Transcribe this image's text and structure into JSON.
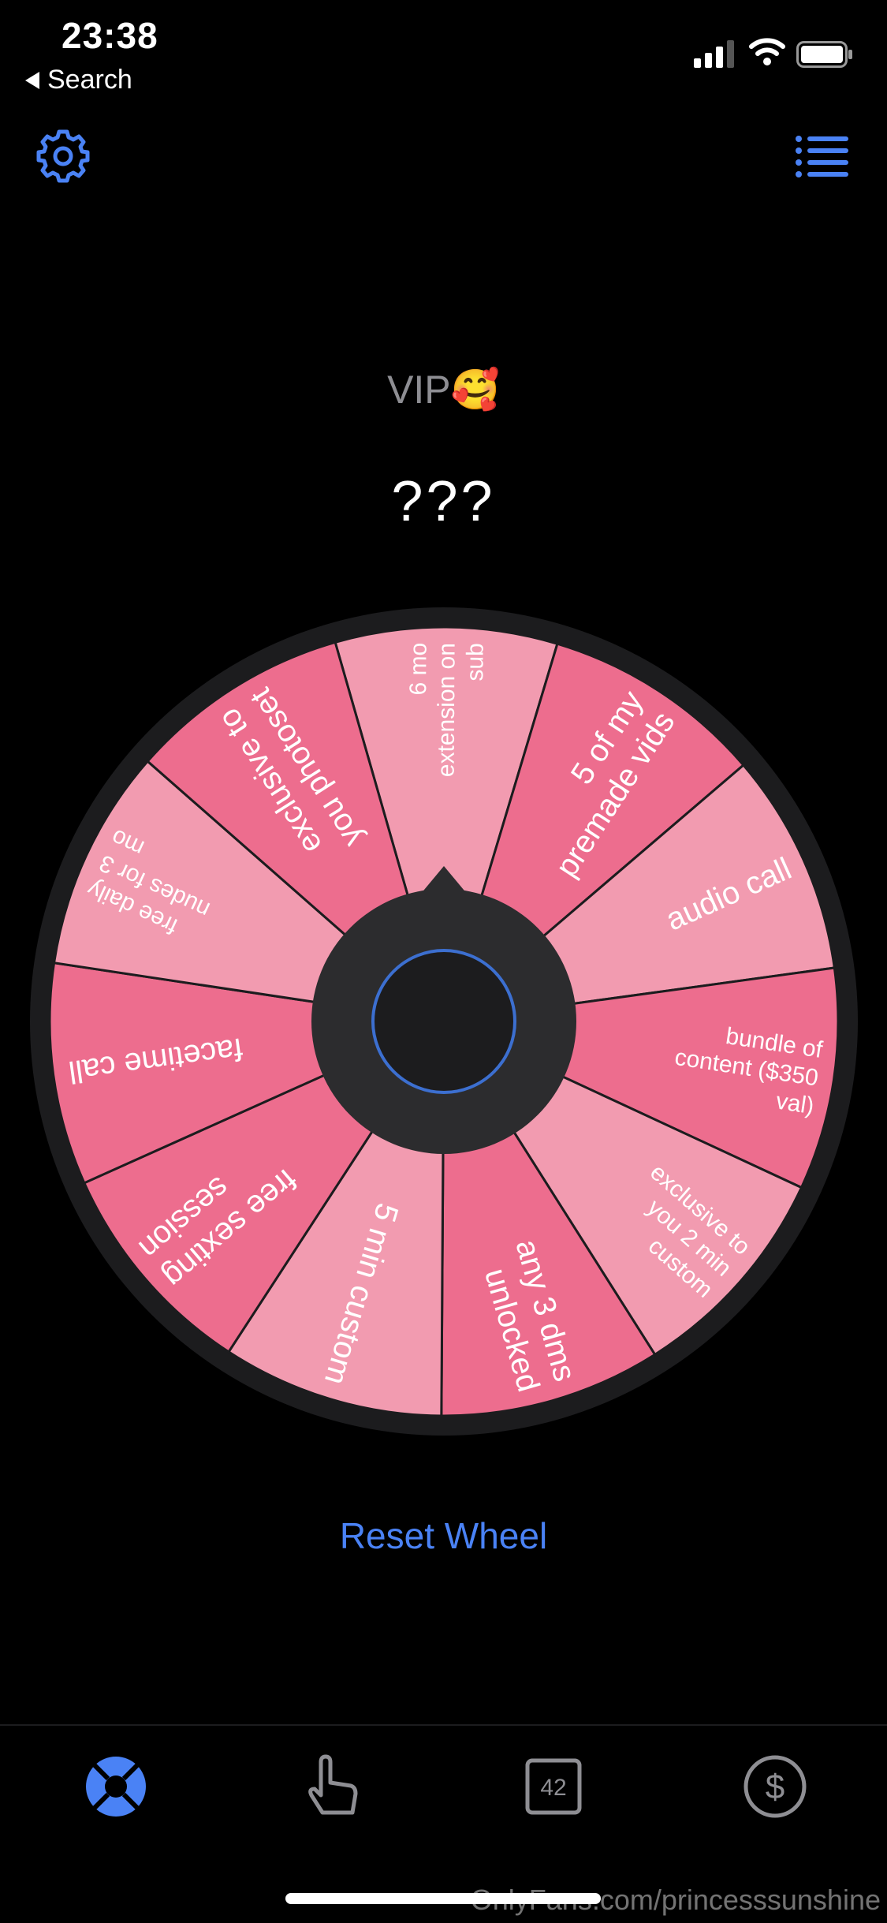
{
  "status_bar": {
    "time": "23:38",
    "back_label": "Search"
  },
  "wheel": {
    "name": "VIP🥰",
    "result": "???",
    "segments": [
      {
        "label": "6 mo extension on sub",
        "color": "#f29bb0"
      },
      {
        "label": "5 of my premade vids",
        "color": "#ed6d8e"
      },
      {
        "label": "audio call",
        "color": "#f29bb0"
      },
      {
        "label": "bundle of content ($350 val)",
        "color": "#ed6d8e"
      },
      {
        "label": "exclusive to you 2 min custom",
        "color": "#f29bb0"
      },
      {
        "label": "any 3 dms unlocked",
        "color": "#ed6d8e"
      },
      {
        "label": "5 min custom",
        "color": "#f29bb0"
      },
      {
        "label": "free sexting session",
        "color": "#ed6d8e"
      },
      {
        "label": "facetime call",
        "color": "#ed6d8e"
      },
      {
        "label": "free daily nudes for 3 mo",
        "color": "#f29bb0"
      },
      {
        "label": "exclusive to you photoset",
        "color": "#ed6d8e"
      }
    ]
  },
  "actions": {
    "reset_label": "Reset Wheel"
  },
  "tab_bar": {
    "items": [
      {
        "name": "wheel",
        "icon": "lifebuoy-icon",
        "active": true
      },
      {
        "name": "tap",
        "icon": "hand-pointer-icon",
        "active": false
      },
      {
        "name": "number",
        "icon": "number-42-icon",
        "badge": "42",
        "active": false
      },
      {
        "name": "money",
        "icon": "dollar-icon",
        "active": false
      }
    ]
  },
  "colors": {
    "accent": "#4a82f5",
    "segment_light": "#f29bb0",
    "segment_dark": "#ed6d8e",
    "wheel_rim": "#1c1c1e",
    "hub": "#2c2c2e"
  },
  "watermark": "OnlyFans.com/princesssunshine"
}
